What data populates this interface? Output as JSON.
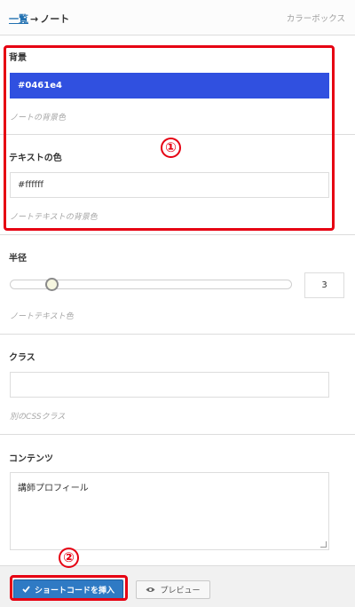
{
  "header": {
    "breadcrumb_link": "一覧",
    "breadcrumb_arrow": "→",
    "breadcrumb_current": "ノート",
    "brand": "カラーボックス"
  },
  "sections": {
    "background": {
      "label": "背景",
      "value": "#0461e4",
      "help": "ノートの背景色"
    },
    "text_color": {
      "label": "テキストの色",
      "value": "#ffffff",
      "help": "ノートテキストの背景色"
    },
    "radius": {
      "label": "半径",
      "value": "3",
      "help": "ノートテキスト色",
      "slider_fraction": 0.15
    },
    "class": {
      "label": "クラス",
      "value": "",
      "help": "別のCSSクラス"
    },
    "contents": {
      "label": "コンテンツ",
      "value": "講師プロフィール"
    }
  },
  "footer": {
    "insert_label": "ショートコードを挿入",
    "preview_label": "プレビュー"
  },
  "annotations": {
    "one": "①",
    "two": "②"
  },
  "colors": {
    "accent": "#2f7ac4",
    "field_blue": "#3050e0",
    "annotation_red": "#e60012"
  },
  "icons": {
    "insert": "check-icon",
    "preview": "eye-icon"
  }
}
